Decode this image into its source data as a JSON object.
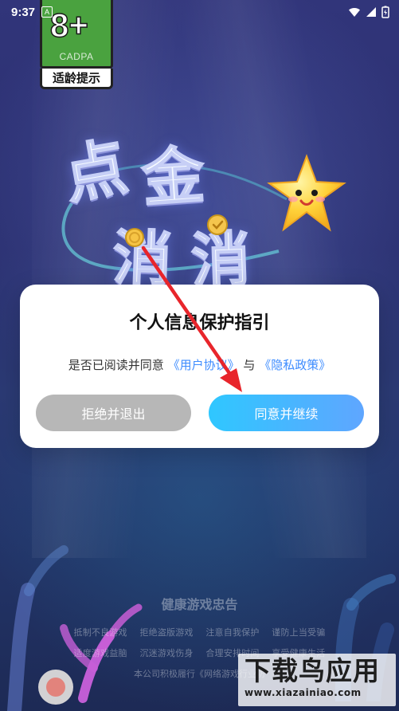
{
  "status_bar": {
    "time": "9:37",
    "notification_badge": "A"
  },
  "age_rating": {
    "number": "8+",
    "org": "CADPA",
    "label": "适龄提示"
  },
  "game_logo": {
    "line1_char1": "点",
    "line1_char2": "金",
    "line2_char1": "消",
    "line2_char2": "消"
  },
  "dialog": {
    "title": "个人信息保护指引",
    "body_prefix": "是否已阅读并同意",
    "user_agreement_link": "《用户协议》",
    "conjunction": "与",
    "privacy_policy_link": "《隐私政策》",
    "reject_button": "拒绝并退出",
    "agree_button": "同意并继续"
  },
  "footer": {
    "title": "健康游戏忠告",
    "row1": [
      "抵制不良游戏",
      "拒绝盗版游戏",
      "注意自我保护",
      "谨防上当受骗"
    ],
    "row2": [
      "适度游戏益脑",
      "沉迷游戏伤身",
      "合理安排时间",
      "享受健康生活"
    ],
    "notice": "本公司积极履行《网络游戏行业防"
  },
  "watermark": {
    "top": "下载鸟应用",
    "bottom": "www.xiazainiao.com"
  },
  "colors": {
    "accent_blue": "#3d8cff",
    "reject_gray": "#b7b7b7",
    "agree_gradient_start": "#2fc7ff",
    "agree_gradient_end": "#5fa6ff",
    "annotation_red": "#e8252b"
  }
}
